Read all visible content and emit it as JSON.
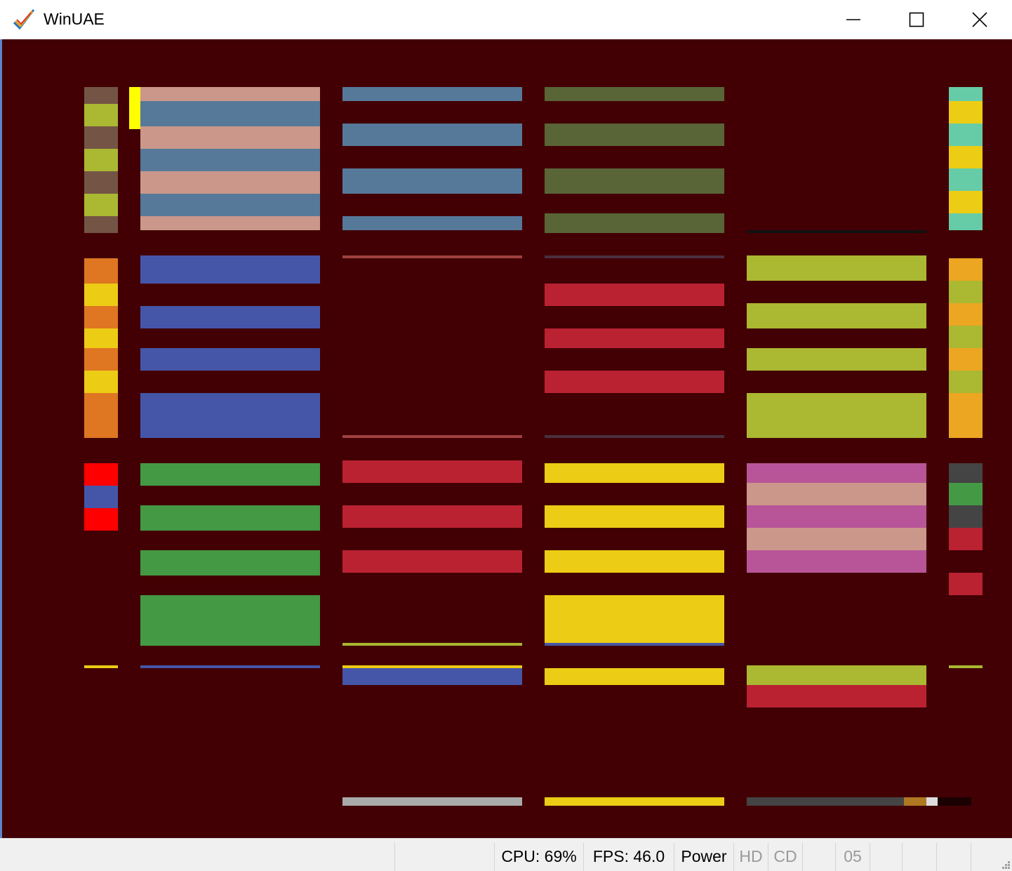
{
  "window": {
    "title": "WinUAE",
    "icon": "winuae-checkmark-icon",
    "controls": [
      "minimize-icon",
      "maximize-icon",
      "close-icon"
    ]
  },
  "emulator_display": {
    "background": "#420004",
    "content": "Amiga screen showing colored horizontal bar pattern"
  },
  "status_bar": {
    "cpu": "CPU: 69%",
    "fps": "FPS: 46.0",
    "power": "Power",
    "hd": "HD",
    "cd": "CD",
    "track": "05"
  }
}
